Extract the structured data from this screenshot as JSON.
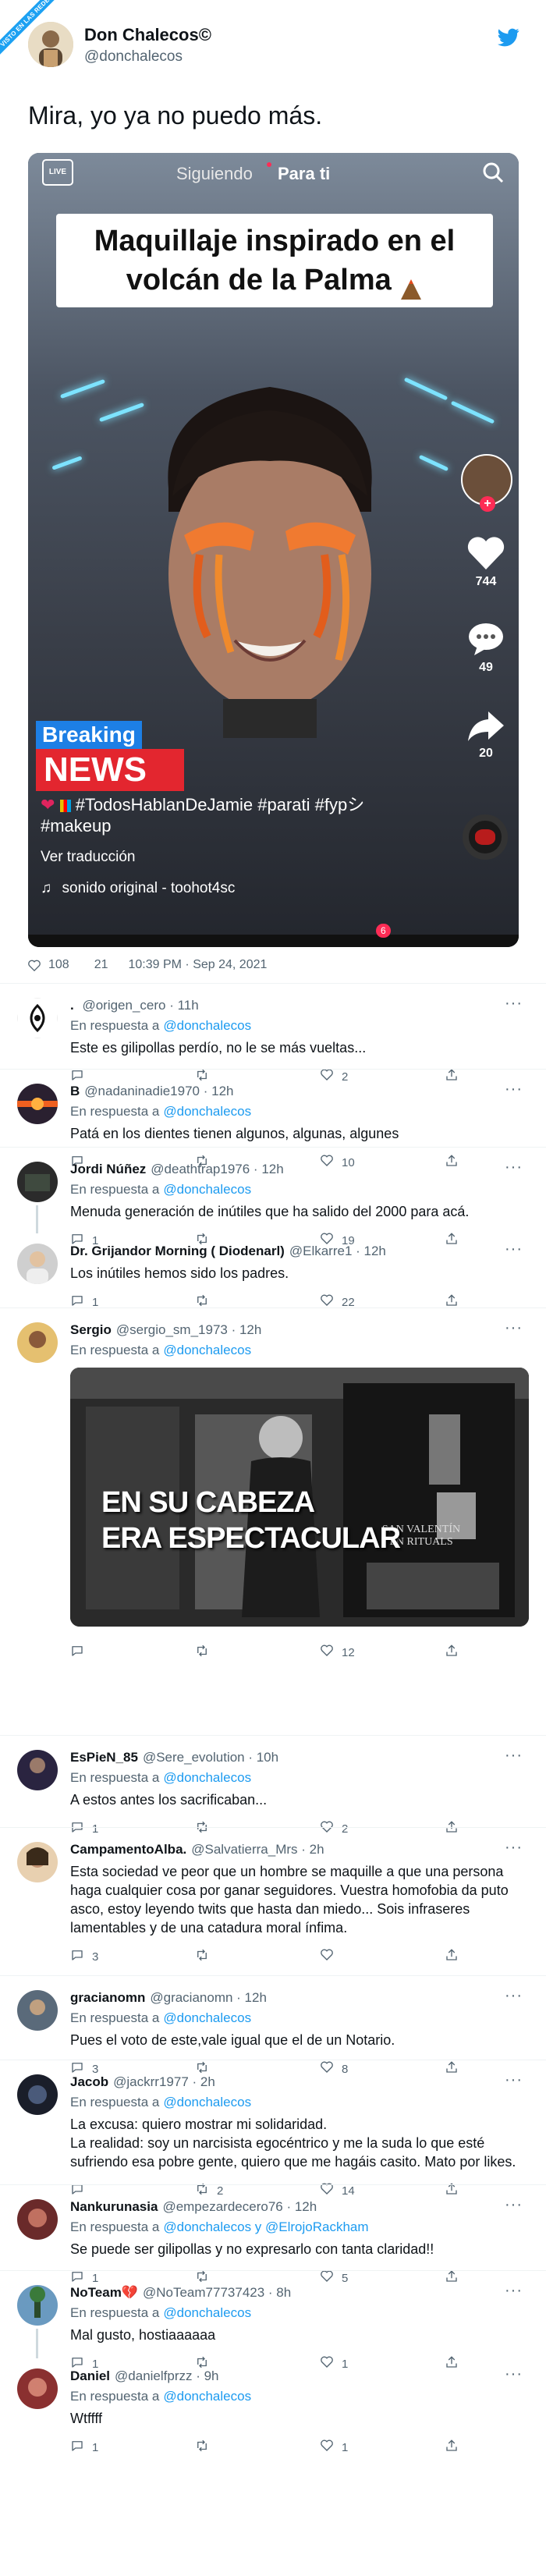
{
  "corner_ribbon": "VISTO EN LAS REDES",
  "tweet": {
    "name": "Don Chalecos©",
    "handle": "@donchalecos",
    "text": "Mira, yo ya no puedo más.",
    "meta_likes": "108",
    "meta_replies": "21",
    "meta_time": "10:39 PM · Sep 24, 2021"
  },
  "video": {
    "tabs": [
      "Siguiendo",
      "Para ti"
    ],
    "live": "LIVE",
    "title": "Maquillaje inspirado en el volcán de la Palma",
    "likes": "744",
    "comments": "49",
    "shares": "20",
    "breaking1": "Breaking",
    "breaking2": "NEWS",
    "hashtags1": "#TodosHablanDeJamie #parati #fypシ",
    "hashtags2": "#makeup",
    "translate": "Ver traducción",
    "sound": "sonido original - toohot4sc",
    "badge": "6"
  },
  "media_caption": [
    "EN SU CABEZA",
    "ERA ESPECTACULAR"
  ],
  "media_shop": [
    "SAN VALENTÍN",
    "EN RITUALS"
  ],
  "in_reply_label": "En respuesta a",
  "more": "···",
  "replies": [
    {
      "name": ". ",
      "handle": "@origen_cero · 11h",
      "resp": "@donchalecos",
      "text": "Este es gilipollas perdío, no le se más vueltas...",
      "rt": "",
      "like": "2",
      "reply": ""
    },
    {
      "name": "B",
      "handle": "@nadaninadie1970 · 12h",
      "resp": "@donchalecos",
      "text": "Patá en los dientes tienen algunos, algunas, algunes",
      "rt": "",
      "like": "10",
      "reply": ""
    },
    {
      "name": "Jordi Núñez",
      "handle": "@deathtrap1976 · 12h",
      "resp": "@donchalecos",
      "text": "Menuda generación de inútiles que ha salido del 2000 para acá.",
      "rt": "",
      "like": "19",
      "reply": "1"
    },
    {
      "name": "Dr. Grijandor Morning ( Diodenarl)",
      "handle": "@Elkarre1 · 12h",
      "resp": "",
      "text": "Los inútiles hemos sido los padres.",
      "rt": "",
      "like": "22",
      "reply": "1"
    },
    {
      "name": "Sergio",
      "handle": "@sergio_sm_1973 · 12h",
      "resp": "@donchalecos",
      "text": "",
      "rt": "",
      "like": "12",
      "reply": ""
    },
    {
      "name": "EsPieN_85",
      "handle": "@Sere_evolution · 10h",
      "resp": "@donchalecos",
      "text": "A estos antes los sacrificaban...",
      "rt": "",
      "like": "2",
      "reply": "1"
    },
    {
      "name": "CampamentoAlba.",
      "handle": "@Salvatierra_Mrs · 2h",
      "resp": "",
      "text": "Esta sociedad ve peor que un hombre se maquille a que una persona haga cualquier cosa por ganar seguidores. Vuestra homofobia da puto asco, estoy leyendo twits que hasta dan miedo... Sois infraseres lamentables y de una catadura moral ínfima.",
      "rt": "",
      "like": "",
      "reply": "3"
    },
    {
      "name": "gracianomn",
      "handle": "@gracianomn · 12h",
      "resp": "@donchalecos",
      "text": "Pues el voto de este,vale igual que el de un Notario.",
      "rt": "",
      "like": "8",
      "reply": "3"
    },
    {
      "name": "Jacob",
      "handle": "@jackrr1977 · 2h",
      "resp": "@donchalecos",
      "text": "La excusa: quiero mostrar mi solidaridad.\nLa realidad: soy un narcisista egocéntrico y me la suda lo que esté sufriendo esa pobre gente, quiero que me hagáis casito. Mato por likes.",
      "rt": "2",
      "like": "14",
      "reply": ""
    },
    {
      "name": "Nankurunasia",
      "handle": "@empezardecero76 · 12h",
      "resp": "@donchalecos y @ElrojoRackham",
      "text": "Se puede ser gilipollas y no expresarlo con tanta claridad!!",
      "rt": "",
      "like": "5",
      "reply": "1"
    },
    {
      "name": "NoTeam",
      "handle": "@NoTeam77737423 · 8h",
      "resp": "@donchalecos",
      "text": "Mal gusto, hostiaaaaaa",
      "rt": "",
      "like": "1",
      "reply": "1"
    },
    {
      "name": "Daniel",
      "handle": "@danielfprzz · 9h",
      "resp": "@donchalecos",
      "text": "Wtffff",
      "rt": "",
      "like": "1",
      "reply": "1"
    }
  ]
}
